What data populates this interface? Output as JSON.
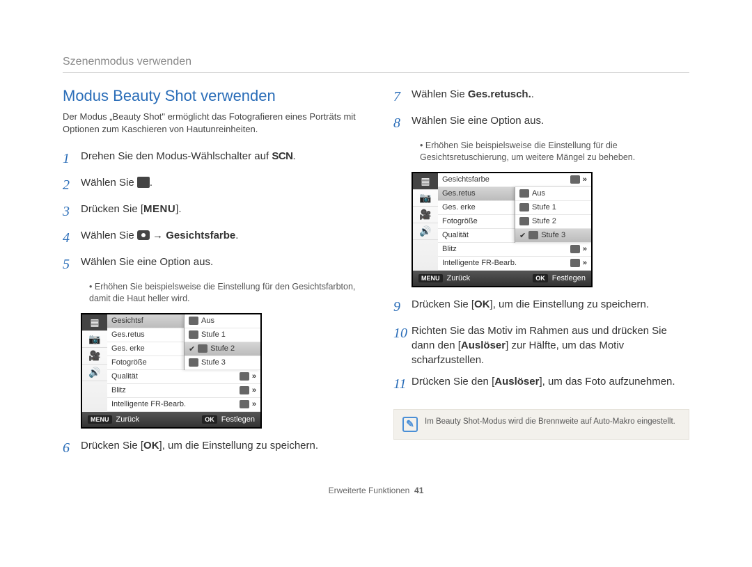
{
  "breadcrumb": "Szenenmodus verwenden",
  "heading": "Modus Beauty Shot verwenden",
  "intro": "Der Modus „Beauty Shot\" ermöglicht das Fotografieren eines Porträts mit Optionen zum Kaschieren von Hautunreinheiten.",
  "steps_left": {
    "s1_pre": "Drehen Sie den Modus-Wählschalter auf ",
    "s1_icon": "SCN",
    "s1_post": ".",
    "s2_pre": "Wählen Sie ",
    "s2_post": ".",
    "s3_pre": "Drücken Sie [",
    "s3_icon": "MENU",
    "s3_post": "].",
    "s4_pre": "Wählen Sie ",
    "s4_arrow": " → ",
    "s4_bold": "Gesichtsfarbe",
    "s4_post": ".",
    "s5": "Wählen Sie eine Option aus.",
    "s5_sub": "Erhöhen Sie beispielsweise die Einstellung für den Gesichtsfarbton, damit die Haut heller wird.",
    "s6_pre": "Drücken Sie [",
    "s6_icon": "OK",
    "s6_post": "], um die Einstellung zu speichern."
  },
  "steps_right": {
    "s7_pre": "Wählen Sie ",
    "s7_bold": "Ges.retusch.",
    "s7_post": ".",
    "s8": "Wählen Sie eine Option aus.",
    "s8_sub": "Erhöhen Sie beispielsweise die Einstellung für die Gesichtsretuschierung, um weitere Mängel zu beheben.",
    "s9_pre": "Drücken Sie [",
    "s9_icon": "OK",
    "s9_post": "], um die Einstellung zu speichern.",
    "s10_pre": "Richten Sie das Motiv im Rahmen aus und drücken Sie dann den [",
    "s10_bold": "Auslöser",
    "s10_post": "] zur Hälfte, um das Motiv scharfzustellen.",
    "s11_pre": "Drücken Sie den [",
    "s11_bold": "Auslöser",
    "s11_post": "], um das Foto aufzunehmen."
  },
  "menu1": {
    "items": [
      "Gesichtsf",
      "Ges.retus",
      "Ges. erke",
      "Fotogröße",
      "Qualität",
      "Blitz",
      "Intelligente FR-Bearb."
    ],
    "popup": [
      "Aus",
      "Stufe 1",
      "Stufe 2",
      "Stufe 3"
    ],
    "selected_row": 0,
    "popup_selected": 2,
    "footer_back": "Zurück",
    "footer_set": "Festlegen",
    "footer_back_key": "MENU",
    "footer_set_key": "OK"
  },
  "menu2": {
    "items": [
      "Gesichtsfarbe",
      "Ges.retus",
      "Ges. erke",
      "Fotogröße",
      "Qualität",
      "Blitz",
      "Intelligente FR-Bearb."
    ],
    "popup": [
      "Aus",
      "Stufe 1",
      "Stufe 2",
      "Stufe 3"
    ],
    "selected_row": 1,
    "popup_selected": 3,
    "footer_back": "Zurück",
    "footer_set": "Festlegen",
    "footer_back_key": "MENU",
    "footer_set_key": "OK"
  },
  "note": "Im Beauty Shot-Modus wird die Brennweite auf Auto-Makro eingestellt.",
  "footer_label": "Erweiterte Funktionen",
  "page_number": "41"
}
